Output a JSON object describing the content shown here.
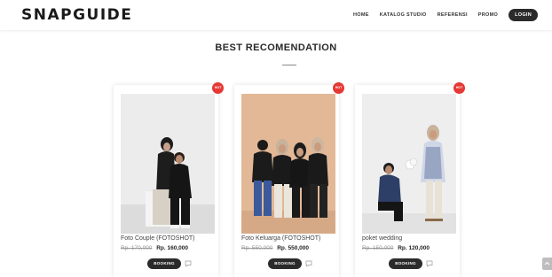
{
  "header": {
    "logo": "SNAPGUIDE",
    "nav": [
      "HOME",
      "KATALOG STUDIO",
      "REFERENSI",
      "PROMO"
    ],
    "login": "LOGIN"
  },
  "section": {
    "title": "BEST RECOMENDATION"
  },
  "cards": [
    {
      "name": "Foto Couple (FOTOSHOT)",
      "old_price": "Rp. 170,000",
      "new_price": "Rp. 160,000",
      "badge": "HOT",
      "button": "BOOKING",
      "bg_color": "#ececec"
    },
    {
      "name": "Foto Keluarga (FOTOSHOT)",
      "old_price": "Rp. 550,000",
      "new_price": "Rp. 550,000",
      "badge": "HOT",
      "button": "BOOKING",
      "bg_color": "#e2b897"
    },
    {
      "name": "poket wedding",
      "old_price": "Rp. 150,000",
      "new_price": "Rp. 120,000",
      "badge": "HOT",
      "button": "BOOKING",
      "bg_color": "#eeeeee"
    }
  ],
  "colors": {
    "accent_red": "#e53935",
    "dark_button": "#2b2b2b"
  }
}
